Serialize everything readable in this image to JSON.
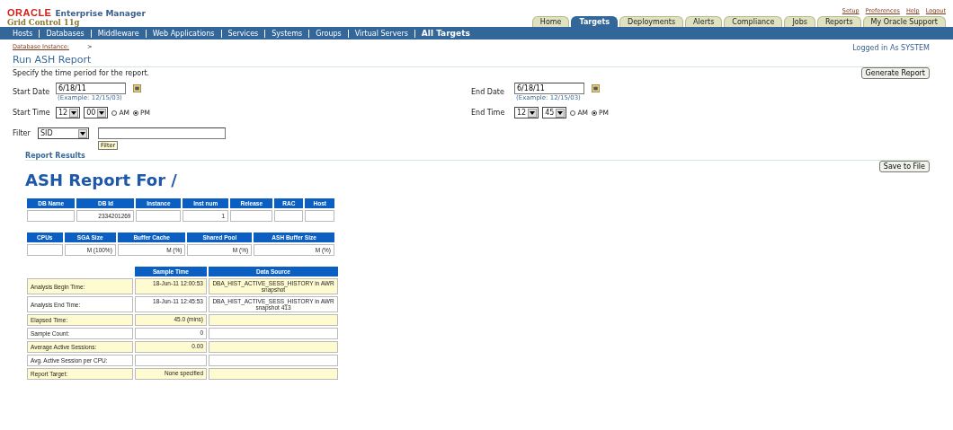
{
  "header": {
    "brand": "ORACLE",
    "product": "Enterprise Manager",
    "subtitle": "Grid Control 11g",
    "global_links": [
      "Setup",
      "Preferences",
      "Help",
      "Logout"
    ]
  },
  "tabs": [
    {
      "label": "Home",
      "selected": false
    },
    {
      "label": "Targets",
      "selected": true
    },
    {
      "label": "Deployments",
      "selected": false
    },
    {
      "label": "Alerts",
      "selected": false
    },
    {
      "label": "Compliance",
      "selected": false
    },
    {
      "label": "Jobs",
      "selected": false
    },
    {
      "label": "Reports",
      "selected": false
    },
    {
      "label": "My Oracle Support",
      "selected": false
    }
  ],
  "subnav": [
    {
      "label": "Hosts",
      "selected": false
    },
    {
      "label": "Databases",
      "selected": false
    },
    {
      "label": "Middleware",
      "selected": false
    },
    {
      "label": "Web Applications",
      "selected": false
    },
    {
      "label": "Services",
      "selected": false
    },
    {
      "label": "Systems",
      "selected": false
    },
    {
      "label": "Groups",
      "selected": false
    },
    {
      "label": "Virtual Servers",
      "selected": false
    },
    {
      "label": "All Targets",
      "selected": true
    }
  ],
  "breadcrumb": {
    "link": "Database Instance:",
    "separator": ">"
  },
  "login_status": "Logged in As SYSTEM",
  "page_title": "Run ASH Report",
  "instructions": "Specify the time period for the report.",
  "generate_button": "Generate Report",
  "start": {
    "date_label": "Start Date",
    "date": "6/18/11",
    "example": "(Example: 12/15/03)",
    "time_label": "Start Time",
    "hour": "12",
    "minute": "00",
    "am_pm": [
      {
        "label": "AM",
        "selected": false
      },
      {
        "label": "PM",
        "selected": true
      }
    ]
  },
  "end": {
    "date_label": "End Date",
    "date": "6/18/11",
    "example": "(Example: 12/15/03)",
    "time_label": "End Time",
    "hour": "12",
    "minute": "45",
    "am_pm": [
      {
        "label": "AM",
        "selected": false
      },
      {
        "label": "PM",
        "selected": true
      }
    ]
  },
  "filter": {
    "label": "Filter",
    "option": "SID",
    "button": "Filter"
  },
  "results_heading": "Report Results",
  "save_button": "Save to File",
  "report_title": "ASH Report For /",
  "db_table": {
    "columns": [
      "DB Name",
      "DB Id",
      "Instance",
      "Inst num",
      "Release",
      "RAC",
      "Host"
    ],
    "rows": [
      [
        "",
        "2334201269",
        "",
        "1",
        "",
        "",
        ""
      ]
    ]
  },
  "mem_table": {
    "columns": [
      "CPUs",
      "SGA Size",
      "Buffer Cache",
      "Shared Pool",
      "ASH Buffer Size"
    ],
    "rows": [
      [
        "",
        "M (100%)",
        "M (%)",
        "M (%)",
        "M (%)"
      ]
    ]
  },
  "summary_table": {
    "columns": [
      "Sample Time",
      "Data Source"
    ],
    "rows": [
      {
        "label": "Analysis Begin Time:",
        "time": "18-Jun-11 12:00:53",
        "source": "DBA_HIST_ACTIVE_SESS_HISTORY in AWR snapshot"
      },
      {
        "label": "Analysis End Time:",
        "time": "18-Jun-11 12:45:53",
        "source": "DBA_HIST_ACTIVE_SESS_HISTORY in AWR snapshot 413"
      },
      {
        "label": "Elapsed Time:",
        "time": "45.0 (mins)",
        "source": ""
      },
      {
        "label": "Sample Count:",
        "time": "0",
        "source": ""
      },
      {
        "label": "Average Active Sessions:",
        "time": "0.00",
        "source": ""
      },
      {
        "label": "Avg. Active Session per CPU:",
        "time": "",
        "source": ""
      },
      {
        "label": "Report Target:",
        "time": "None specified",
        "source": ""
      }
    ]
  }
}
